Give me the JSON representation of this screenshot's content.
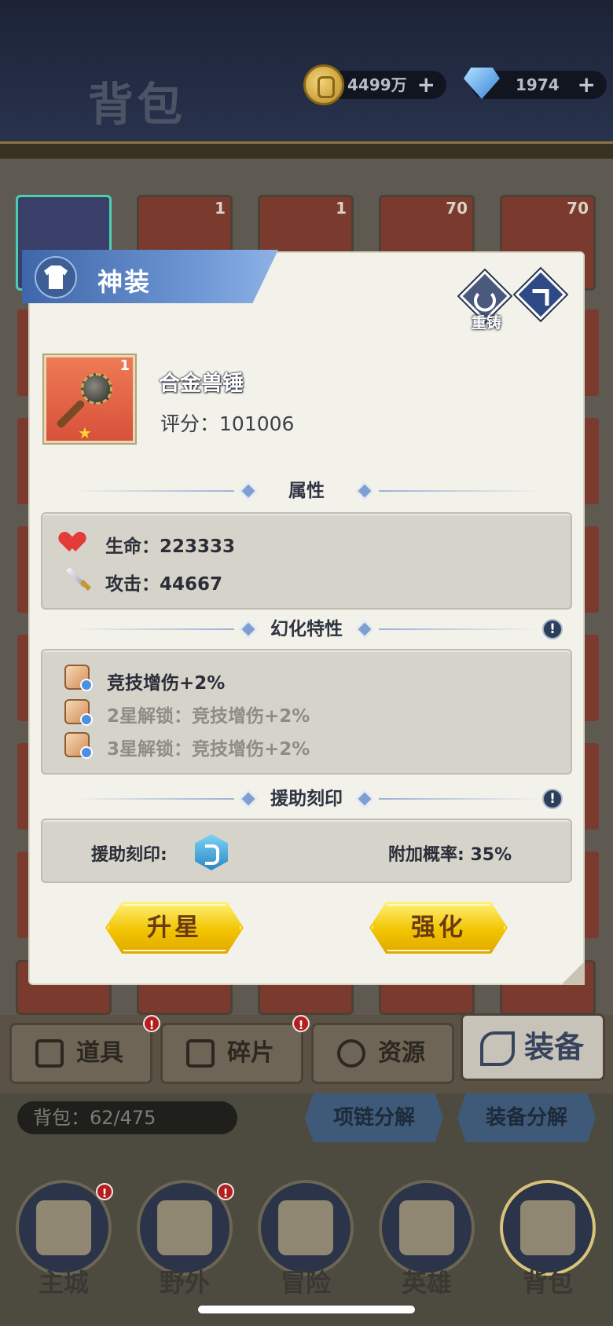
{
  "header": {
    "title": "背包",
    "gold": "4499万",
    "gems": "1974",
    "plus": "+"
  },
  "grid": {
    "slot_counts": [
      "1",
      "1",
      "70",
      "70"
    ]
  },
  "modal": {
    "ribbon_title": "神装",
    "reforge_label": "重铸",
    "item": {
      "name": "合金兽锤",
      "count": "1",
      "score_label": "评分：",
      "score": "101006",
      "star": "★"
    },
    "attributes": {
      "title": "属性",
      "hp_label": "生命：",
      "hp": "223333",
      "atk_label": "攻击：",
      "atk": "44667"
    },
    "transform": {
      "title": "幻化特性",
      "info": "!",
      "lines": [
        "竞技增伤+2%",
        "2星解锁：竞技增伤+2%",
        "3星解锁：竞技增伤+2%"
      ]
    },
    "support": {
      "title": "援助刻印",
      "info": "!",
      "label": "援助刻印:",
      "chance_label": "附加概率:",
      "chance": "35%"
    },
    "buttons": {
      "upgrade_star": "升星",
      "enhance": "强化"
    }
  },
  "category_tabs": [
    "道具",
    "碎片",
    "资源",
    "装备"
  ],
  "badge_mark": "!",
  "bag": {
    "count_label": "背包：",
    "count": "62/475",
    "necklace_decompose": "项链分解",
    "equip_decompose": "装备分解"
  },
  "nav": [
    "主城",
    "野外",
    "冒险",
    "英雄",
    "背包"
  ],
  "colors": {
    "accent_blue": "#3f66a8",
    "button_yellow": "#f2c400",
    "badge_red": "#b51e1e"
  }
}
